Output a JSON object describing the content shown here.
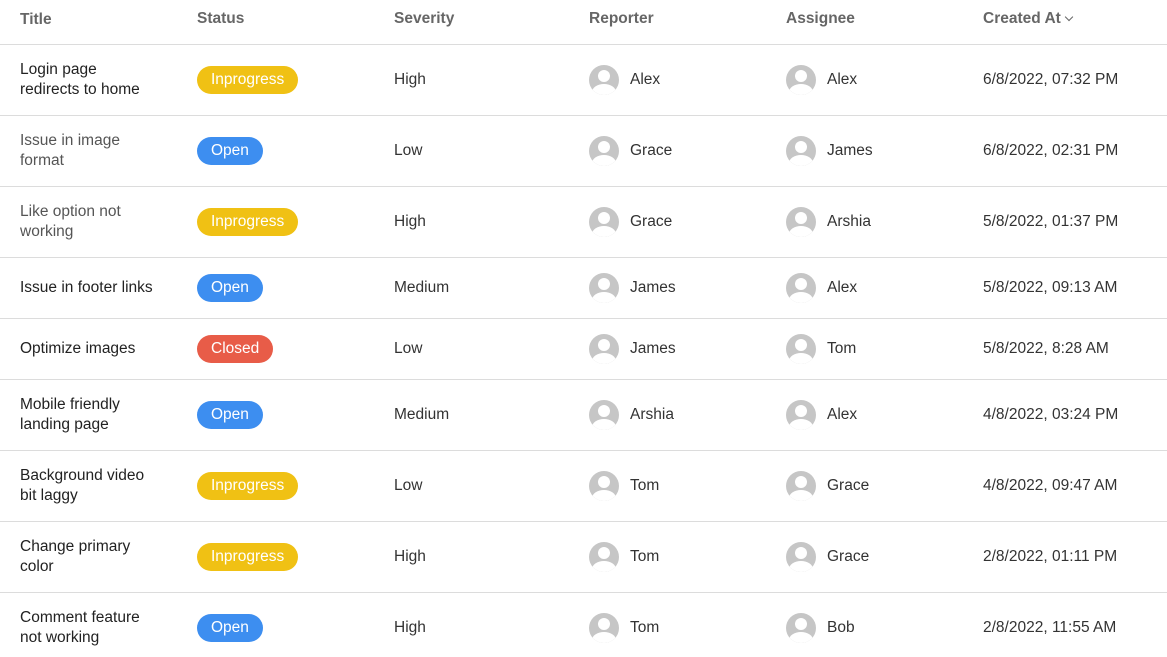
{
  "headers": {
    "title": "Title",
    "status": "Status",
    "severity": "Severity",
    "reporter": "Reporter",
    "assignee": "Assignee",
    "created_at": "Created At"
  },
  "status_colors": {
    "Inprogress": "#f0c114",
    "Open": "#3d8ef0",
    "Closed": "#e85c48"
  },
  "rows": [
    {
      "title": [
        "Login page",
        "redirects to home"
      ],
      "status": "Inprogress",
      "severity": "High",
      "reporter": "Alex",
      "assignee": "Alex",
      "created_at": "6/8/2022, 07:32 PM"
    },
    {
      "title": [
        "Issue in image",
        "format"
      ],
      "status": "Open",
      "severity": "Low",
      "reporter": "Grace",
      "assignee": "James",
      "created_at": "6/8/2022, 02:31 PM"
    },
    {
      "title": [
        "Like option not",
        "working"
      ],
      "status": "Inprogress",
      "severity": "High",
      "reporter": "Grace",
      "assignee": "Arshia",
      "created_at": "5/8/2022, 01:37 PM"
    },
    {
      "title": [
        "Issue in footer links"
      ],
      "status": "Open",
      "severity": "Medium",
      "reporter": "James",
      "assignee": "Alex",
      "created_at": "5/8/2022, 09:13 AM"
    },
    {
      "title": [
        "Optimize images"
      ],
      "status": "Closed",
      "severity": "Low",
      "reporter": "James",
      "assignee": "Tom",
      "created_at": "5/8/2022, 8:28 AM"
    },
    {
      "title": [
        "Mobile friendly",
        "landing page"
      ],
      "status": "Open",
      "severity": "Medium",
      "reporter": "Arshia",
      "assignee": "Alex",
      "created_at": "4/8/2022, 03:24 PM"
    },
    {
      "title": [
        "Background video",
        "bit laggy"
      ],
      "status": "Inprogress",
      "severity": "Low",
      "reporter": "Tom",
      "assignee": "Grace",
      "created_at": "4/8/2022, 09:47 AM"
    },
    {
      "title": [
        "Change primary",
        "color"
      ],
      "status": "Inprogress",
      "severity": "High",
      "reporter": "Tom",
      "assignee": "Grace",
      "created_at": "2/8/2022, 01:11 PM"
    },
    {
      "title": [
        "Comment feature",
        "not working"
      ],
      "status": "Open",
      "severity": "High",
      "reporter": "Tom",
      "assignee": "Bob",
      "created_at": "2/8/2022, 11:55 AM"
    }
  ]
}
